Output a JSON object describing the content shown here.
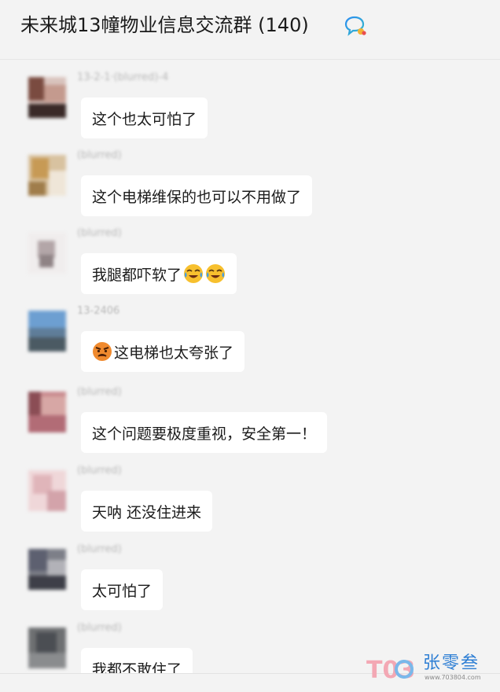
{
  "header": {
    "title": "未来城13幢物业信息交流群 (140)",
    "icon": "group-chat-icon"
  },
  "messages": [
    {
      "sender": "13-2-1·(blurred)-4",
      "text": "这个也太可怕了"
    },
    {
      "sender": "(blurred)",
      "text": "这个电梯维保的也可以不用做了"
    },
    {
      "sender": "(blurred)",
      "text": "我腿都吓软了",
      "trailing_emoji": "crying-laughing-emoji",
      "emoji_count": 2
    },
    {
      "sender": "13-2406",
      "text": "这电梯也太夸张了",
      "leading_emoji": "angry-face-emoji"
    },
    {
      "sender": "(blurred)",
      "text": "这个问题要极度重视，安全第一！"
    },
    {
      "sender": "(blurred)",
      "text": "天呐 还没住进来"
    },
    {
      "sender": "(blurred)",
      "text": "太可怕了"
    },
    {
      "sender": "(blurred)",
      "text": "我都不敢住了"
    }
  ],
  "watermark": {
    "logo": "T03",
    "name": "张零叁",
    "url": "www.703804.com"
  },
  "colors": {
    "background": "#f3f3f3",
    "bubble": "#ffffff",
    "watermark_blue": "#2f7fd4"
  }
}
